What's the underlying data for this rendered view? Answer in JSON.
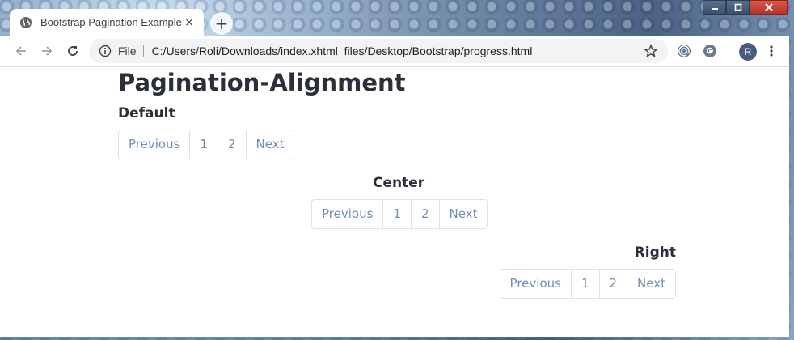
{
  "browser": {
    "tab_title": "Bootstrap Pagination Example",
    "tab_close": "×",
    "new_tab_symbol": "+",
    "address": {
      "scheme_label": "File",
      "url": "C:/Users/Roli/Downloads/index.xhtml_files/Desktop/Bootstrap/progress.html"
    },
    "profile_initial": "R",
    "icons": {
      "back": "arrow-left-icon",
      "forward": "arrow-right-icon",
      "reload": "reload-icon",
      "info": "info-icon",
      "bookmark": "star-icon",
      "extension_1": "at-sign-icon",
      "extension_2": "google-icon",
      "menu": "kebab-menu-icon"
    }
  },
  "page": {
    "title": "Pagination-Alignment",
    "sections": [
      {
        "label": "Default",
        "align": "left",
        "links": [
          "Previous",
          "1",
          "2",
          "Next"
        ]
      },
      {
        "label": "Center",
        "align": "center",
        "links": [
          "Previous",
          "1",
          "2",
          "Next"
        ]
      },
      {
        "label": "Right",
        "align": "right",
        "links": [
          "Previous",
          "1",
          "2",
          "Next"
        ]
      }
    ]
  },
  "colors": {
    "link": "#6f8eb5",
    "heading": "#2b2f3a",
    "border": "#dee2e6"
  }
}
